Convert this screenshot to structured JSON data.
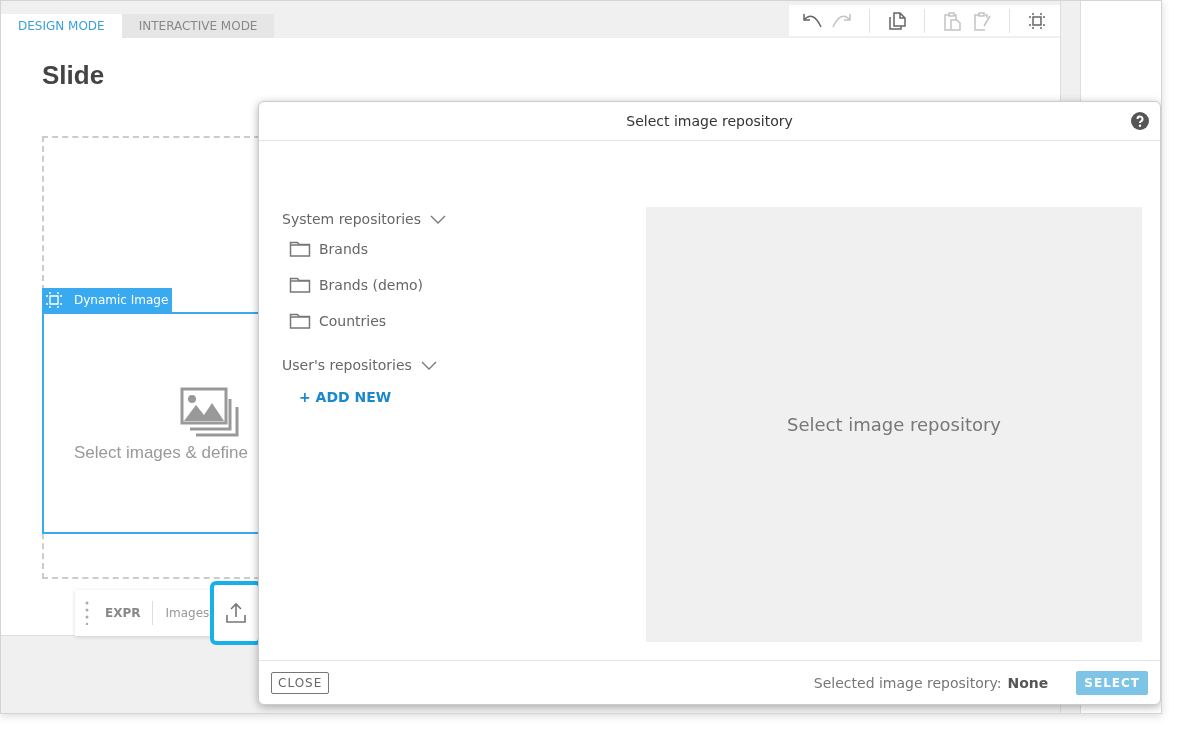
{
  "tabs": [
    {
      "label": "DESIGN MODE",
      "selected": true
    },
    {
      "label": "INTERACTIVE MODE",
      "selected": false
    }
  ],
  "toolbar": [
    {
      "kind": "undo",
      "disabled": false
    },
    {
      "kind": "redo",
      "disabled": true
    },
    {
      "kind": "copy",
      "disabled": false
    },
    {
      "kind": "paste",
      "disabled": true
    },
    {
      "kind": "paste-format",
      "disabled": true
    },
    {
      "kind": "select-frame",
      "disabled": false
    }
  ],
  "slide": {
    "title": "Slide",
    "widget": {
      "label": "Dynamic Image",
      "hint": "Select images & define"
    }
  },
  "widget_toolbar": {
    "expr": "EXPR",
    "images": "Images"
  },
  "dialog": {
    "title": "Select image repository",
    "sections": [
      {
        "label": "System repositories",
        "expanded": true,
        "children": [
          {
            "label": "Brands"
          },
          {
            "label": "Brands (demo)"
          },
          {
            "label": "Countries"
          }
        ]
      },
      {
        "label": "User's repositories",
        "expanded": true,
        "action": "+ ADD NEW"
      }
    ],
    "preview": "Select image repository",
    "close": "CLOSE",
    "selected_label": "Selected image repository:",
    "selected_value": "None",
    "select": {
      "label": "SELECT",
      "disabled": true
    }
  }
}
